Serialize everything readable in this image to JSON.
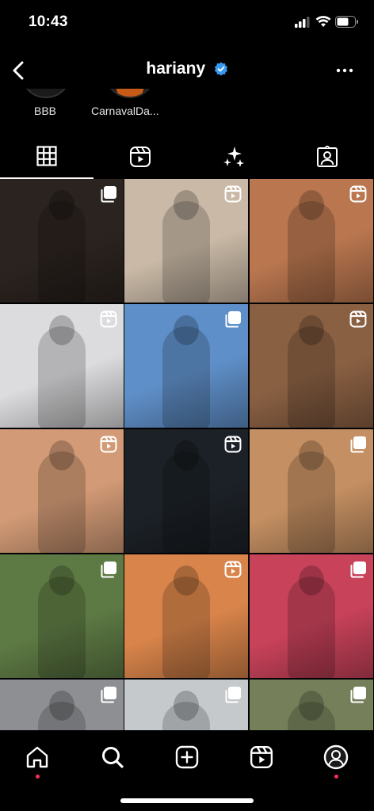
{
  "status_bar": {
    "time": "10:43"
  },
  "header": {
    "username": "hariany",
    "verified": true
  },
  "highlights": [
    {
      "label": "BBB"
    },
    {
      "label": "CarnavalDa..."
    }
  ],
  "tabs": [
    {
      "name": "posts-grid",
      "icon": "grid-icon",
      "active": true
    },
    {
      "name": "reels",
      "icon": "reels-icon",
      "active": false
    },
    {
      "name": "collabs",
      "icon": "sparkles-icon",
      "active": false
    },
    {
      "name": "tagged",
      "icon": "tagged-person-icon",
      "active": false
    }
  ],
  "grid": {
    "posts": [
      {
        "type": "carousel",
        "bg": "#2b231f"
      },
      {
        "type": "reel",
        "bg": "#c9b9a6"
      },
      {
        "type": "reel",
        "bg": "#b9764f"
      },
      {
        "type": "reel",
        "bg": "#dcdcde"
      },
      {
        "type": "carousel",
        "bg": "#5f8fc8"
      },
      {
        "type": "reel",
        "bg": "#8a6043"
      },
      {
        "type": "reel",
        "bg": "#d29a76"
      },
      {
        "type": "reel",
        "bg": "#1c2127"
      },
      {
        "type": "carousel",
        "bg": "#c48f62"
      },
      {
        "type": "carousel",
        "bg": "#5e7a44"
      },
      {
        "type": "reel",
        "bg": "#d8844a"
      },
      {
        "type": "carousel",
        "bg": "#c8425a"
      },
      {
        "type": "carousel",
        "bg": "#8d8f93"
      },
      {
        "type": "carousel",
        "bg": "#c5c9cc"
      },
      {
        "type": "carousel",
        "bg": "#75805a"
      }
    ]
  },
  "bottom_nav": [
    {
      "name": "home",
      "icon": "home-icon",
      "notification": true
    },
    {
      "name": "search",
      "icon": "search-icon",
      "notification": false
    },
    {
      "name": "create",
      "icon": "plus-square-icon",
      "notification": false
    },
    {
      "name": "reels",
      "icon": "reels-icon",
      "notification": false
    },
    {
      "name": "profile",
      "icon": "profile-icon",
      "notification": true
    }
  ],
  "colors": {
    "background": "#000000",
    "verified_badge": "#3897f0",
    "notification_dot": "#ff2d55"
  }
}
